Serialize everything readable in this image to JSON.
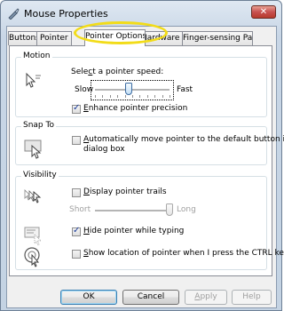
{
  "window": {
    "title": "Mouse Properties",
    "close_glyph": "✕"
  },
  "tabs": [
    {
      "label": "Buttons"
    },
    {
      "label": "Pointer"
    },
    {
      "label": "Pointer Options",
      "active": true
    },
    {
      "label": "Hardware"
    },
    {
      "label": "Finger-sensing Pad"
    }
  ],
  "motion": {
    "group_label": "Motion",
    "speed_prefix": "Sele",
    "speed_accel": "c",
    "speed_suffix": "t a pointer speed:",
    "slow": "Slow",
    "fast": "Fast",
    "speed_level": 0.45,
    "precision_accel": "E",
    "precision_rest": "nhance pointer precision",
    "precision_checked": true
  },
  "snap": {
    "group_label": "Snap To",
    "line1_accel": "A",
    "line1_rest": "utomatically move pointer to the default button in a",
    "line2": "dialog box",
    "checked": false
  },
  "visibility": {
    "group_label": "Visibility",
    "trails_accel": "D",
    "trails_rest": "isplay pointer trails",
    "trails_checked": false,
    "short": "Short",
    "long": "Long",
    "trails_level": 1.0,
    "hide_accel": "H",
    "hide_rest": "ide pointer while typing",
    "hide_checked": true,
    "show_accel": "S",
    "show_rest": "how location of pointer when I press the CTRL key",
    "show_checked": false
  },
  "buttons": {
    "ok": "OK",
    "cancel": "Cancel",
    "apply_accel": "A",
    "apply_rest": "pply",
    "help": "Help"
  },
  "colors": {
    "highlight": "#f2dc18",
    "close": "#c75050"
  },
  "icons": [
    "mouse-icon",
    "pointer-speed-icon",
    "snap-to-icon",
    "pointer-trails-icon",
    "hide-pointer-icon",
    "show-location-icon"
  ]
}
